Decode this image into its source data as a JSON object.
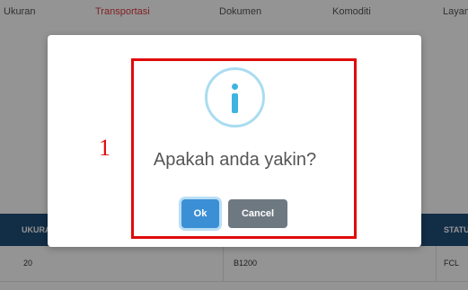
{
  "nav": {
    "tabs": [
      {
        "label": "Ukuran"
      },
      {
        "label": "Transportasi"
      },
      {
        "label": "Dokumen"
      },
      {
        "label": "Komoditi"
      },
      {
        "label": "Layanan"
      }
    ],
    "active_tab": "Transportasi"
  },
  "table": {
    "headers": [
      "UKURAN",
      "STATUS"
    ],
    "rows": [
      [
        "20",
        "B1200",
        "FCL"
      ]
    ]
  },
  "dialog": {
    "icon": "info-icon",
    "message": "Apakah anda yakin?",
    "ok_label": "Ok",
    "cancel_label": "Cancel"
  },
  "annotation": {
    "marker_label": "1"
  },
  "colors": {
    "header_bg": "#1f4e79",
    "active_tab": "#e0393e",
    "ok_button": "#3b8fd4",
    "cancel_button": "#6e7881",
    "info_icon": "#3fb4e0",
    "highlight_box": "#e00a0a"
  }
}
